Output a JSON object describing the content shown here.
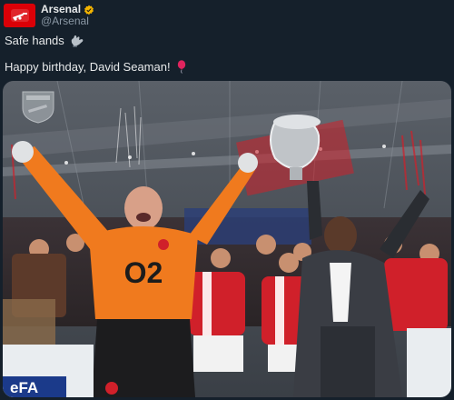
{
  "account": {
    "display_name": "Arsenal",
    "handle": "@Arsenal",
    "avatar_icon": "arsenal-cannon-crest-icon",
    "verified_icon": "verified-badge-icon",
    "brand_color": "#db0007",
    "verified_color": "#f4b400"
  },
  "tweet": {
    "line1": "Safe hands",
    "line1_emoji": "gloves-icon",
    "line2": "Happy birthday, David Seaman!",
    "line2_emoji": "balloon-icon"
  },
  "media": {
    "type": "photo",
    "shirt_text": "O2",
    "board_text": "eFA",
    "crest_icon": "arsenal-crest-watermark-icon"
  },
  "colors": {
    "background": "#15202b",
    "text": "#e7e9ea",
    "secondary_text": "#8b98a5",
    "keeper_kit": "#f07a1e"
  }
}
